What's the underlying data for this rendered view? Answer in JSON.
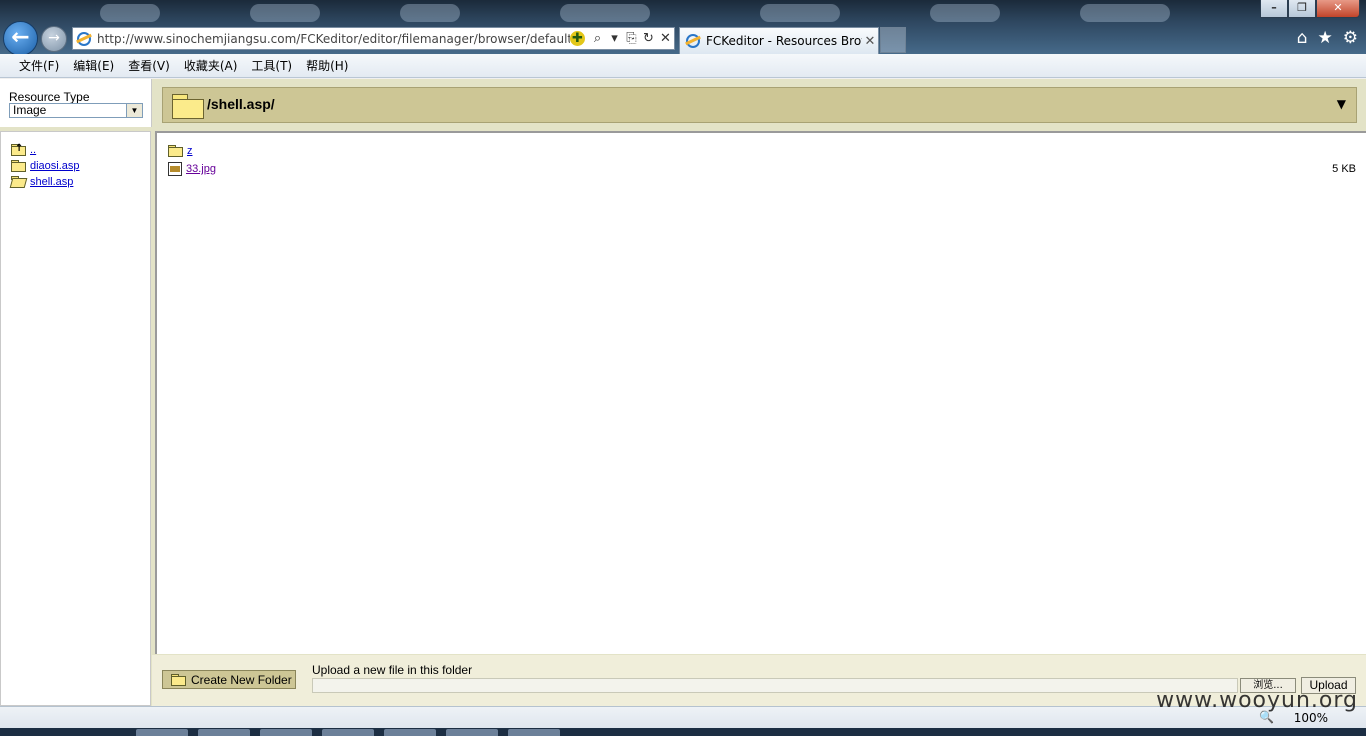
{
  "browser": {
    "address_url": "http://www.sinochemjiangsu.com/FCKeditor/editor/filemanager/browser/default/",
    "tab_title": "FCKeditor - Resources Browser",
    "zoom_level": "100%",
    "menu": [
      "文件(F)",
      "编辑(E)",
      "查看(V)",
      "收藏夹(A)",
      "工具(T)",
      "帮助(H)"
    ]
  },
  "resource_type": {
    "label": "Resource Type",
    "selected": "Image"
  },
  "header": {
    "current_folder": "/shell.asp/"
  },
  "folder_tree": [
    {
      "name": ".."
    },
    {
      "name": "diaosi.asp"
    },
    {
      "name": "shell.asp"
    }
  ],
  "files": [
    {
      "name": "z",
      "size": ""
    },
    {
      "name": "33.jpg",
      "size": "5 KB"
    }
  ],
  "upload": {
    "create_folder_label": "Create New Folder",
    "upload_label": "Upload a new file in this folder",
    "browse_label": "浏览...",
    "upload_button": "Upload"
  },
  "watermark": "www.wooyun.org",
  "colors": {
    "header_bg": "#cdc695",
    "link": "#0000cc",
    "visited_link": "#660099"
  }
}
